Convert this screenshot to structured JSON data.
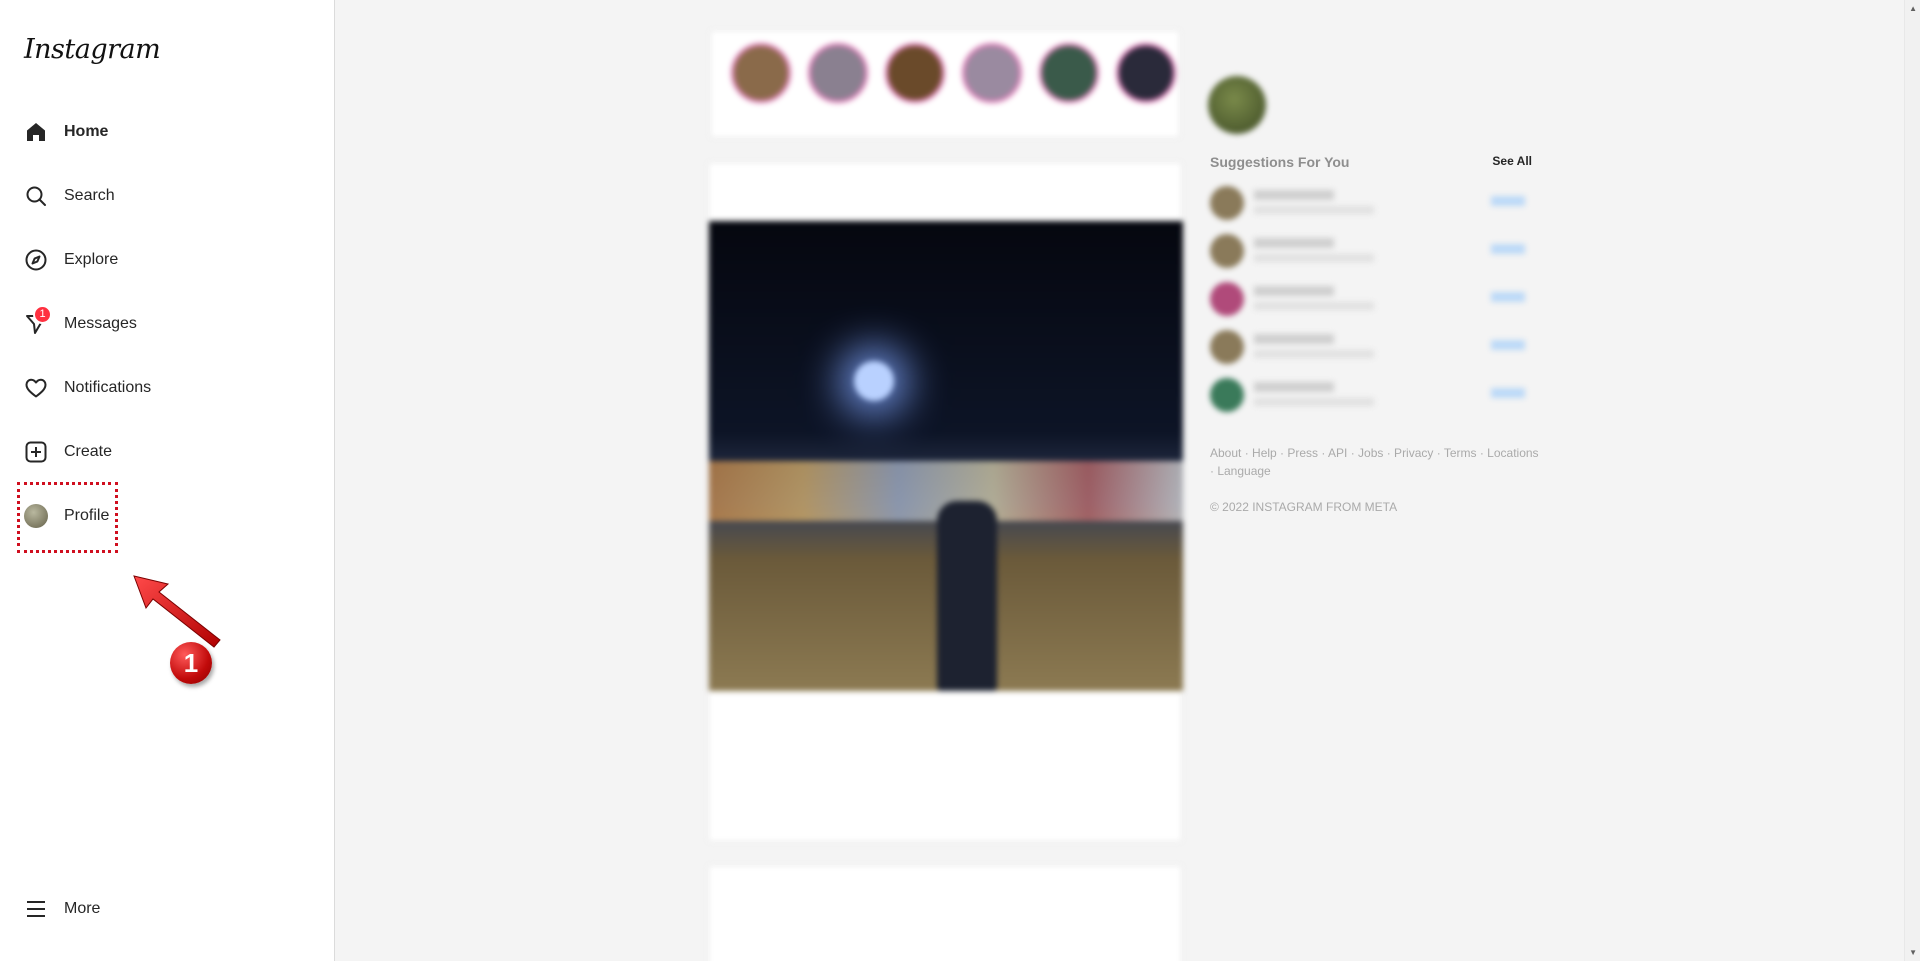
{
  "brand": {
    "logo_text": "Instagram"
  },
  "sidebar": {
    "items": [
      {
        "label": "Home",
        "icon": "home-icon"
      },
      {
        "label": "Search",
        "icon": "search-icon"
      },
      {
        "label": "Explore",
        "icon": "compass-icon"
      },
      {
        "label": "Messages",
        "icon": "messenger-icon",
        "badge": "1"
      },
      {
        "label": "Notifications",
        "icon": "heart-icon"
      },
      {
        "label": "Create",
        "icon": "plus-square-icon"
      },
      {
        "label": "Profile",
        "icon": "avatar"
      }
    ],
    "more": {
      "label": "More",
      "icon": "menu-icon"
    }
  },
  "annotation": {
    "step": "1",
    "color": "#d00f1f"
  },
  "suggestions": {
    "title": "Suggestions For You",
    "see_all": "See All"
  },
  "footer": {
    "links": "About · Help · Press · API · Jobs · Privacy · Terms · Locations · Language",
    "copyright": "© 2022 INSTAGRAM FROM META"
  },
  "colors": {
    "accent_badge": "#ff3040",
    "link_blue": "#0095f6"
  }
}
